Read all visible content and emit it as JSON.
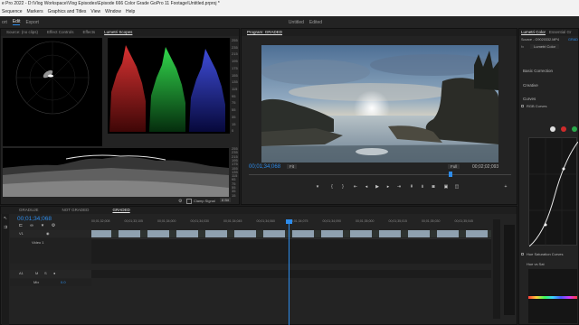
{
  "app": {
    "title": "e Pro 2022 - D:\\Vlog Workspace\\Vlog Episodes\\Episode 666 Color Grade GoPro 11 Footage\\Untitled.prproj *",
    "menu": [
      "Sequence",
      "Markers",
      "Graphics and Titles",
      "View",
      "Window",
      "Help"
    ]
  },
  "workspaces": {
    "items": [
      "ort",
      "Edit",
      "Export"
    ],
    "active": "Edit",
    "center_items": [
      "Untitled",
      "Edited"
    ]
  },
  "scopes_panel": {
    "tabs": [
      "Source: (no clips)",
      "Effect Controls",
      "Effects",
      "Lumetri Scopes"
    ],
    "active_tab": "Lumetri Scopes",
    "parade_ticks": [
      "255",
      "235",
      "215",
      "195",
      "175",
      "155",
      "135",
      "115",
      "95",
      "75",
      "55",
      "35",
      "15",
      "0"
    ],
    "waveform_ticks": [
      "255",
      "235",
      "215",
      "195",
      "175",
      "155",
      "135",
      "115",
      "95",
      "75",
      "55",
      "35",
      "15"
    ],
    "clamp_label": "Clamp Signal",
    "bit_depth": "8 Bit"
  },
  "program": {
    "title": "Program: GRADED",
    "timecode": "00;01;34;068",
    "fit_label": "Fit",
    "full_label": "Full",
    "duration": "00;02;02;093"
  },
  "lumetri": {
    "tabs": [
      "Lumetri Color",
      "Essential Gr"
    ],
    "source_label": "Source - G9020332.MP4",
    "master_label": "GRAD",
    "fx_label": "Lumetri Color",
    "sections": [
      "Basic Correction",
      "Creative",
      "Curves"
    ],
    "rgb_curves": "RGB Curves",
    "hue_sat": "Hue Saturation Curves",
    "hue_vs_sat": "Hue vs Sat",
    "colors": {
      "white": "#e0e0e0",
      "red": "#d02b2b",
      "green": "#2aa84a",
      "accent": "#2d8ceb"
    }
  },
  "timeline": {
    "tabs": [
      "GRADUJE",
      "NOT GRADED",
      "GRADED"
    ],
    "active_tab": "GRADED",
    "timecode": "00;01;34;068",
    "ruler": [
      "00;01;32;008",
      "00;01;33;105",
      "00;01;34;000",
      "00;01;34;030",
      "00;01;34;045",
      "00;01;34;060",
      "00;01;34;075",
      "00;01;34;090",
      "00;01;35;000",
      "00;01;35;015",
      "00;01;35;030",
      "00;01;35;045"
    ],
    "tracks": [
      {
        "name": "V1",
        "label": "Video 1"
      },
      {
        "name": "A1",
        "label": "A1"
      }
    ],
    "mix_label": "Mix",
    "mix_value": "0.0"
  }
}
